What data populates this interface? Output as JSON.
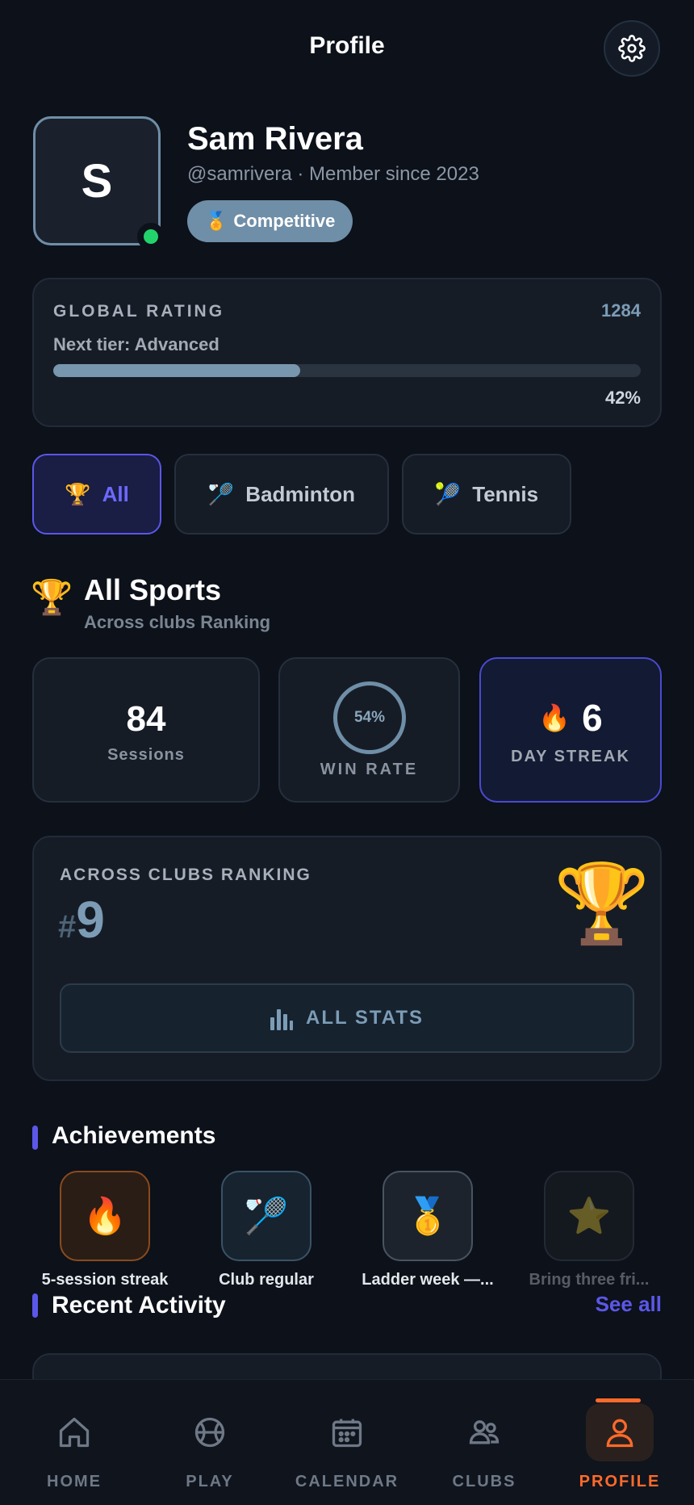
{
  "header": {
    "title": "Profile"
  },
  "profile": {
    "avatar_initial": "S",
    "name": "Sam Rivera",
    "subtitle": "@samrivera · Member since 2023",
    "badge_icon": "🏅",
    "badge": "Competitive"
  },
  "rating": {
    "label": "GLOBAL RATING",
    "value": "1284",
    "next_tier": "Next tier: Advanced",
    "progress_percent": 42,
    "progress_text": "42%"
  },
  "sport_tabs": [
    {
      "icon": "🏆",
      "label": "All",
      "active": true
    },
    {
      "icon": "🏸",
      "label": "Badminton",
      "active": false
    },
    {
      "icon": "🎾",
      "label": "Tennis",
      "active": false
    }
  ],
  "section": {
    "icon": "🏆",
    "title": "All Sports",
    "subtitle": "Across clubs Ranking"
  },
  "stats": {
    "sessions_value": "84",
    "sessions_label": "Sessions",
    "win_rate_value": "54%",
    "win_rate_label": "WIN RATE",
    "streak_icon": "🔥",
    "streak_value": "6",
    "streak_label": "DAY STREAK"
  },
  "ranking": {
    "label": "ACROSS CLUBS RANKING",
    "hash": "#",
    "value": "9",
    "trophy_icon": "🏆",
    "button_label": "ALL STATS"
  },
  "achievements": {
    "title": "Achievements",
    "items": [
      {
        "icon": "🔥",
        "label": "5-session streak"
      },
      {
        "icon": "🏸",
        "label": "Club regular"
      },
      {
        "icon": "🥇",
        "label": "Ladder week —..."
      },
      {
        "icon": "⭐",
        "label": "Bring three fri..."
      }
    ]
  },
  "recent": {
    "title": "Recent Activity",
    "see_all": "See all"
  },
  "nav": {
    "items": [
      {
        "icon": "home-icon",
        "label": "HOME"
      },
      {
        "icon": "play-icon",
        "label": "PLAY"
      },
      {
        "icon": "calendar-icon",
        "label": "CALENDAR"
      },
      {
        "icon": "clubs-icon",
        "label": "CLUBS"
      },
      {
        "icon": "profile-icon",
        "label": "PROFILE",
        "active": true
      }
    ]
  },
  "colors": {
    "background": "#0c111a",
    "accent": "#5b57e8",
    "rating_blue": "#6f8ea7",
    "nav_active": "#ff6a2b",
    "online": "#22d36b"
  }
}
